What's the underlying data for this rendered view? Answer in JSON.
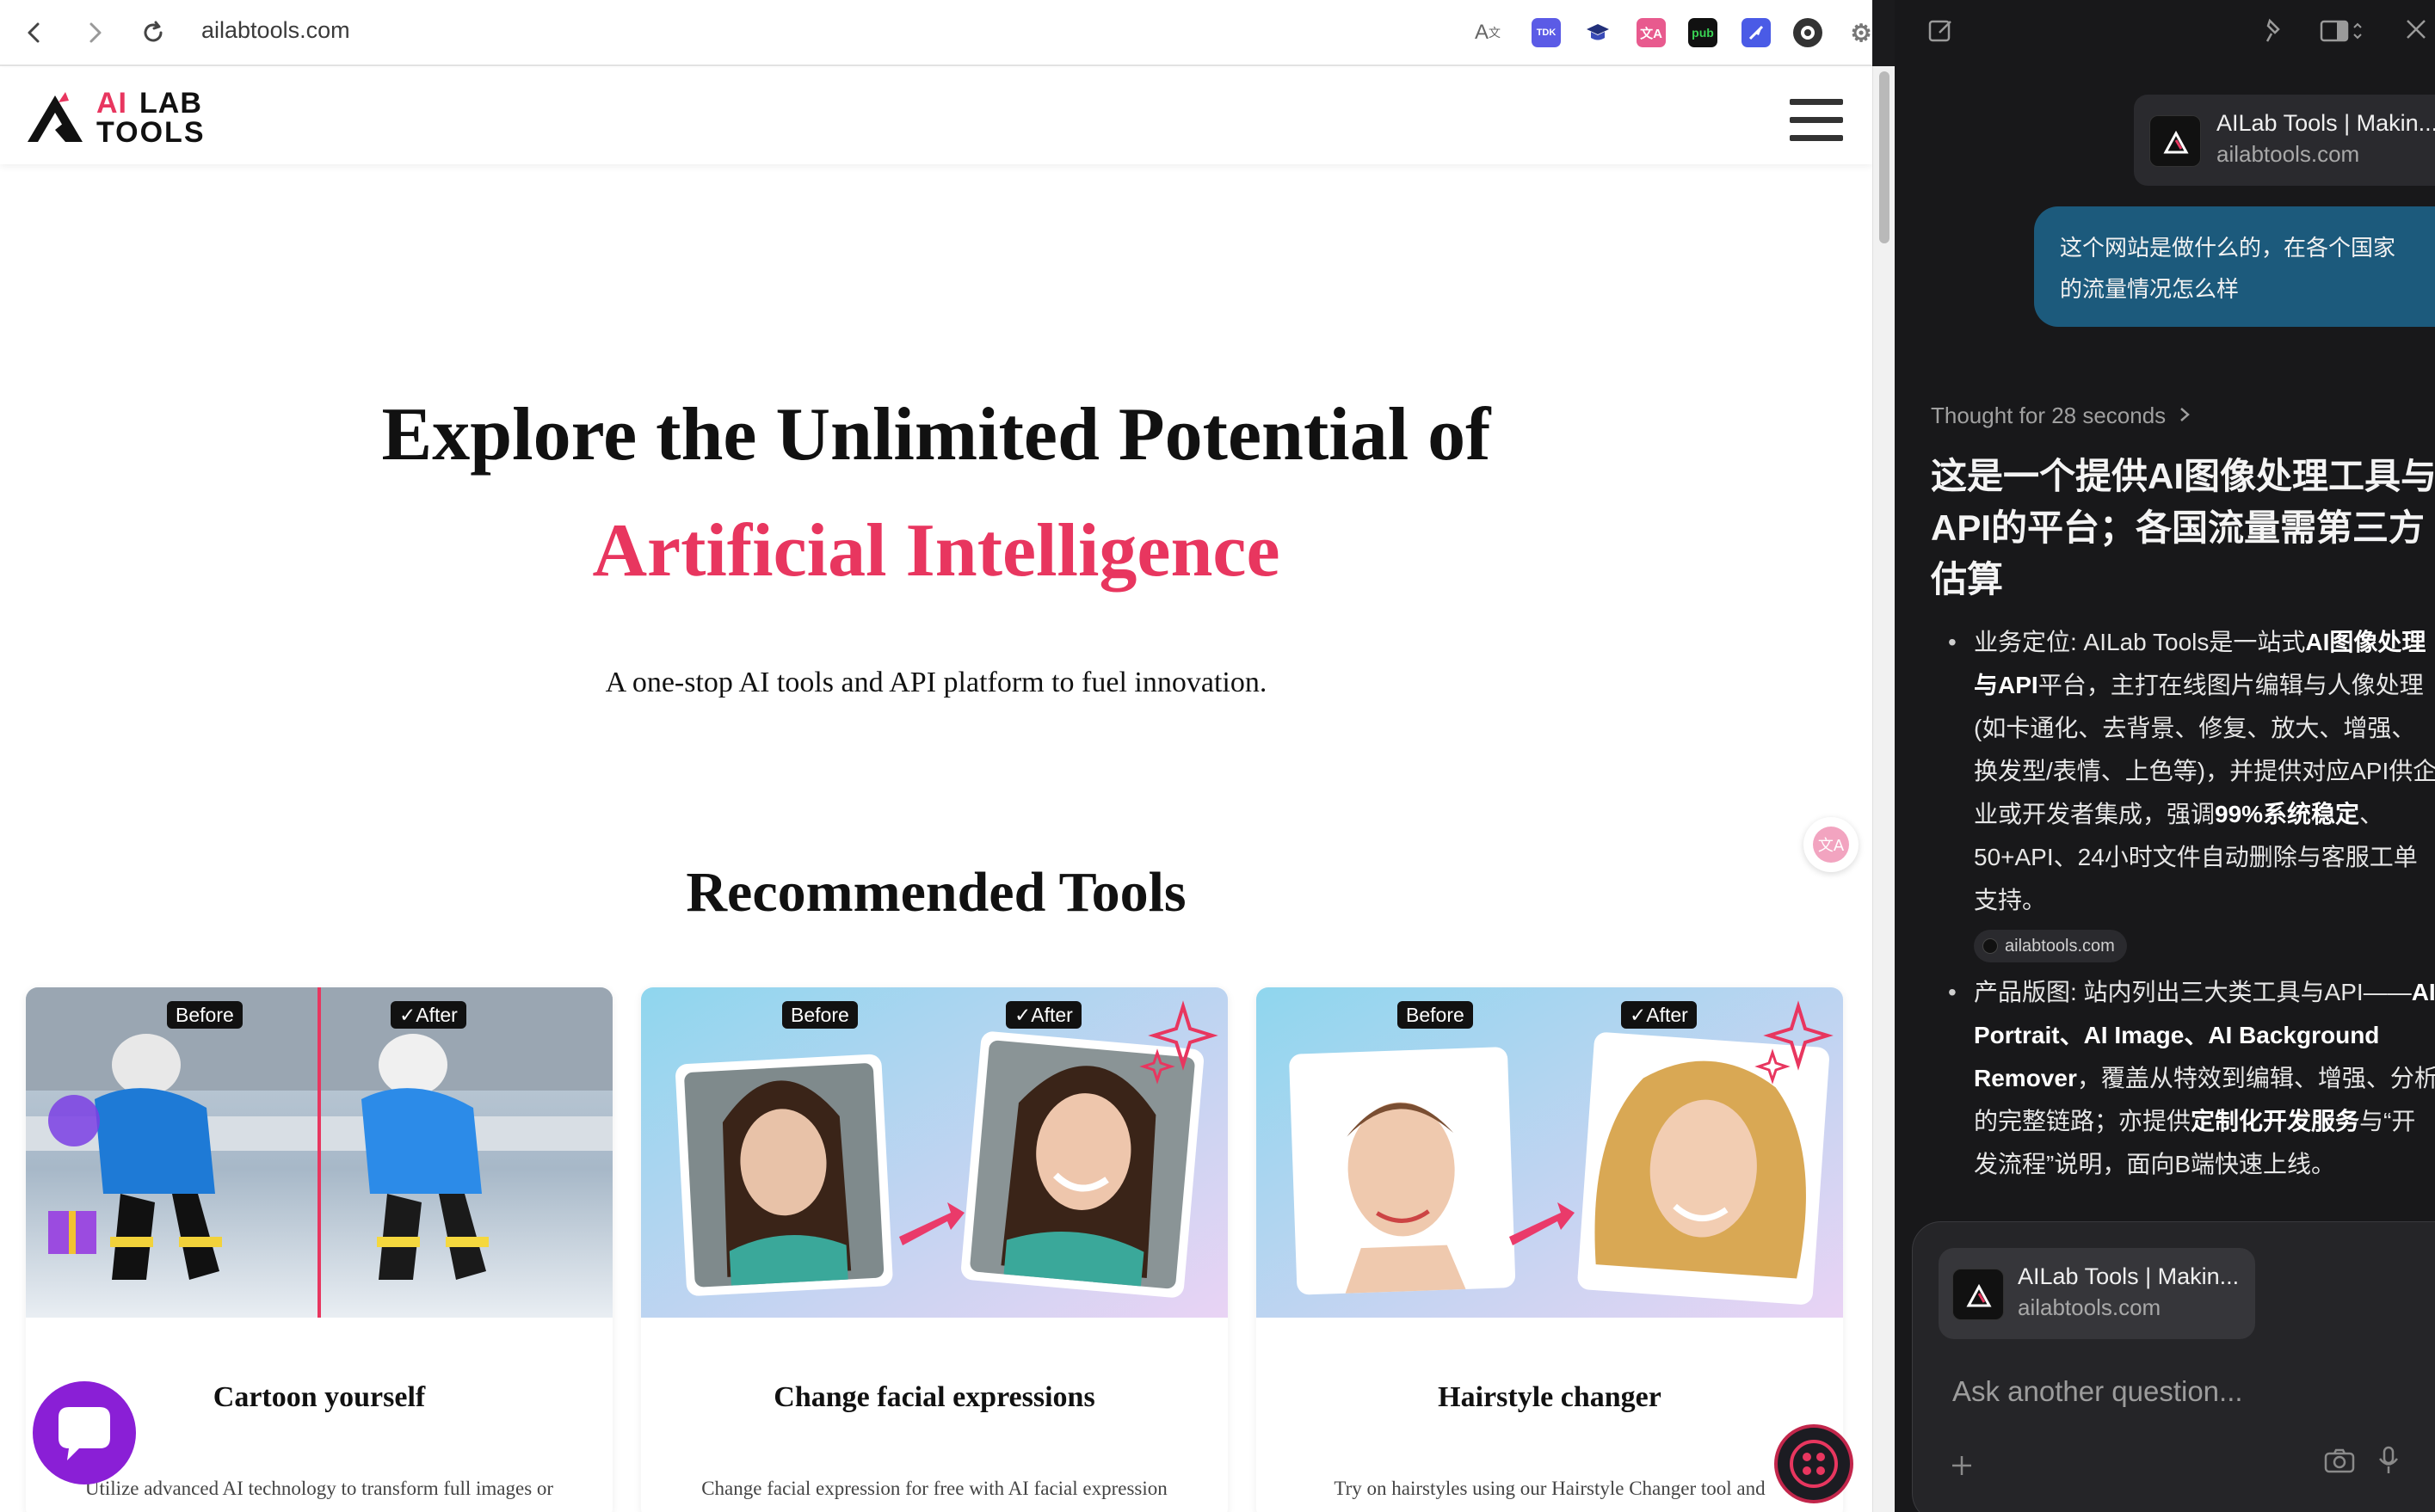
{
  "browser": {
    "url": "ailabtools.com",
    "extensions": [
      "translate-icon",
      "tdk-extension",
      "graduation-cap-extension",
      "translate-extension",
      "pub-extension",
      "quill-extension",
      "github-extension",
      "settings-extension"
    ],
    "ext_tdk_label": "TDK",
    "ext_pub_label": "pub"
  },
  "site": {
    "logo_ai": "AI",
    "logo_lab": "LAB",
    "logo_tools": "TOOLS",
    "hero_line1": "Explore the Unlimited Potential of",
    "hero_line2": "Artificial Intelligence",
    "hero_sub": "A one-stop AI tools and API platform to fuel innovation.",
    "recommended_title": "Recommended Tools",
    "accent_color": "#e8365f",
    "cards": [
      {
        "title": "Cartoon yourself",
        "desc": "Utilize advanced AI technology to transform full images or",
        "before": "Before",
        "after": "✓After"
      },
      {
        "title": "Change facial expressions",
        "desc": "Change facial expression for free with AI facial expression",
        "before": "Before",
        "after": "✓After"
      },
      {
        "title": "Hairstyle changer",
        "desc": "Try on hairstyles using our Hairstyle Changer tool and",
        "before": "Before",
        "after": "✓After"
      }
    ]
  },
  "panel": {
    "source_title": "AILab Tools | Makin...",
    "source_url": "ailabtools.com",
    "user_message_line1": "这个网站是做什么的，在各个国家",
    "user_message_line2": "的流量情况怎么样",
    "thought": "Thought for 28 seconds",
    "answer_title": "这是一个提供AI图像处理工具与API的平台；各国流量需第三方估算",
    "bullet1_prefix": "业务定位: AILab Tools是一站式",
    "bullet1_bold1": "AI图像处理与API",
    "bullet1_mid": "平台，主打在线图片编辑与人像处理 (如卡通化、去背景、修复、放大、增强、换发型/表情、上色等)，并提供对应API供企业或开发者集成，强调",
    "bullet1_bold2": "99%系统稳定",
    "bullet1_tail": "、50+API、24小时文件自动删除与客服工单支持。",
    "citation": "ailabtools.com",
    "bullet2_prefix": "产品版图: 站内列出三大类工具与API——",
    "bullet2_bold1": "AI Portrait、AI Image、AI Background Remover",
    "bullet2_mid": "，覆盖从特效到编辑、增强、分析的完整链路；亦提供",
    "bullet2_bold2": "定制化开发服务",
    "bullet2_tail": "与“开发流程”说明，面向B端快速上线。",
    "composer_placeholder": "Ask another question...",
    "composer_source_title": "AILab Tools | Makin...",
    "composer_source_url": "ailabtools.com"
  }
}
